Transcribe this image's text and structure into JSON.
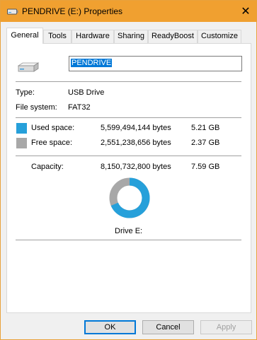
{
  "window": {
    "title": "PENDRIVE (E:) Properties",
    "close_glyph": "✕",
    "accent_color": "#f0a030"
  },
  "tabs": [
    {
      "label": "General",
      "active": true
    },
    {
      "label": "Tools",
      "active": false
    },
    {
      "label": "Hardware",
      "active": false
    },
    {
      "label": "Sharing",
      "active": false
    },
    {
      "label": "ReadyBoost",
      "active": false
    },
    {
      "label": "Customize",
      "active": false
    }
  ],
  "general": {
    "drive_name": "PENDRIVE",
    "type_label": "Type:",
    "type_value": "USB Drive",
    "fs_label": "File system:",
    "fs_value": "FAT32",
    "used": {
      "label": "Used space:",
      "bytes": "5,599,494,144 bytes",
      "size": "5.21 GB",
      "color": "#26a0da"
    },
    "free": {
      "label": "Free space:",
      "bytes": "2,551,238,656 bytes",
      "size": "2.37 GB",
      "color": "#a8a8a8"
    },
    "capacity": {
      "label": "Capacity:",
      "bytes": "8,150,732,800 bytes",
      "size": "7.59 GB"
    },
    "used_fraction": 0.687,
    "drive_caption": "Drive E:"
  },
  "buttons": {
    "ok": "OK",
    "cancel": "Cancel",
    "apply": "Apply"
  }
}
